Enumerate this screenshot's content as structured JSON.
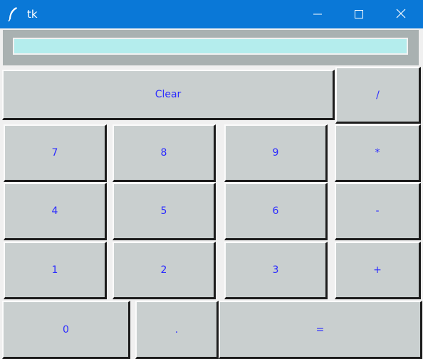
{
  "window": {
    "title": "tk",
    "title_bar_color": "#0a78d7",
    "app_icon": "feather-icon",
    "controls": [
      "minimize-icon",
      "maximize-icon",
      "close-icon"
    ]
  },
  "display": {
    "value": "",
    "background": "#b4eded"
  },
  "buttons": {
    "clear": "Clear",
    "divide": "/",
    "multiply": "*",
    "subtract": "-",
    "add": "+",
    "seven": "7",
    "eight": "8",
    "nine": "9",
    "four": "4",
    "five": "5",
    "six": "6",
    "one": "1",
    "two": "2",
    "three": "3",
    "zero": "0",
    "decimal": ".",
    "equals": "="
  },
  "colors": {
    "button_face": "#c9cfcf",
    "button_text": "#2b2bff"
  }
}
